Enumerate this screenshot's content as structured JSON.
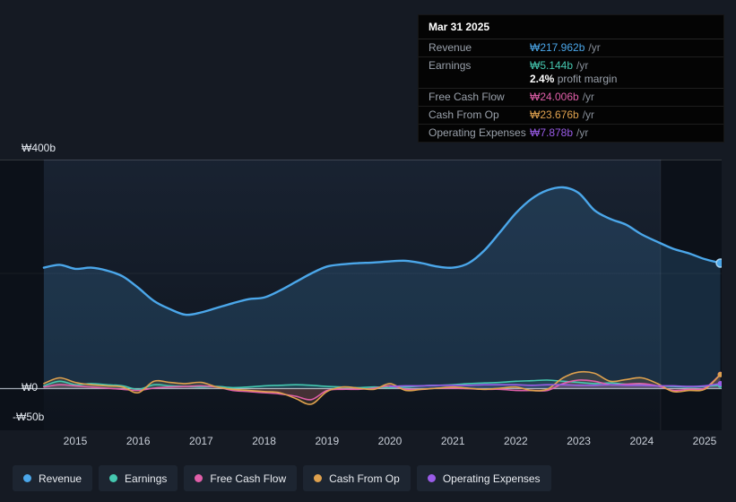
{
  "tooltip": {
    "date": "Mar 31 2025",
    "rows": [
      {
        "label": "Revenue",
        "value": "₩217.962b",
        "suffix": "/yr",
        "color": "#4ba7ea"
      },
      {
        "label": "Earnings",
        "value": "₩5.144b",
        "suffix": "/yr",
        "color": "#45c8b0",
        "sub": {
          "value": "2.4%",
          "label": "profit margin"
        }
      },
      {
        "label": "Free Cash Flow",
        "value": "₩24.006b",
        "suffix": "/yr",
        "color": "#e05fa9"
      },
      {
        "label": "Cash From Op",
        "value": "₩23.676b",
        "suffix": "/yr",
        "color": "#dfa14e"
      },
      {
        "label": "Operating Expenses",
        "value": "₩7.878b",
        "suffix": "/yr",
        "color": "#9a5ce8"
      }
    ]
  },
  "axis": {
    "y_top": "₩400b",
    "y_zero": "₩0",
    "y_neg": "-₩50b",
    "x_ticks": [
      "2015",
      "2016",
      "2017",
      "2018",
      "2019",
      "2020",
      "2021",
      "2022",
      "2023",
      "2024",
      "2025"
    ]
  },
  "legend": [
    {
      "label": "Revenue",
      "color": "#4ba7ea"
    },
    {
      "label": "Earnings",
      "color": "#45c8b0"
    },
    {
      "label": "Free Cash Flow",
      "color": "#e05fa9"
    },
    {
      "label": "Cash From Op",
      "color": "#dfa14e"
    },
    {
      "label": "Operating Expenses",
      "color": "#9a5ce8"
    }
  ],
  "chart_data": {
    "type": "line",
    "unit": "₩ billions per year",
    "x_unit": "year",
    "legend_position": "bottom",
    "ylim": [
      -75,
      400
    ],
    "y_ticks_labeled": [
      {
        "value": 400,
        "label": "₩400b"
      },
      {
        "value": 0,
        "label": "₩0"
      },
      {
        "value": -50,
        "label": "-₩50b"
      }
    ],
    "highlight_divider_x": 2024.3,
    "x": [
      2014.5,
      2014.75,
      2015,
      2015.25,
      2015.5,
      2015.75,
      2016,
      2016.25,
      2016.5,
      2016.75,
      2017,
      2017.25,
      2017.5,
      2017.75,
      2018,
      2018.25,
      2018.5,
      2018.75,
      2019,
      2019.25,
      2019.5,
      2019.75,
      2020,
      2020.25,
      2020.5,
      2020.75,
      2021,
      2021.25,
      2021.5,
      2021.75,
      2022,
      2022.25,
      2022.5,
      2022.75,
      2023,
      2023.25,
      2023.5,
      2023.75,
      2024,
      2024.25,
      2024.5,
      2024.75,
      2025,
      2025.25
    ],
    "series": [
      {
        "name": "Revenue",
        "color": "#4ba7ea",
        "fill": true,
        "values": [
          210,
          215,
          208,
          210,
          205,
          195,
          175,
          152,
          138,
          128,
          132,
          140,
          148,
          155,
          158,
          170,
          185,
          200,
          212,
          216,
          218,
          219,
          221,
          222,
          218,
          212,
          210,
          218,
          240,
          272,
          305,
          330,
          345,
          350,
          340,
          310,
          295,
          285,
          268,
          255,
          243,
          235,
          225,
          218
        ]
      },
      {
        "name": "Earnings",
        "color": "#45c8b0",
        "values": [
          4,
          12,
          6,
          8,
          6,
          4,
          -2,
          6,
          4,
          3,
          2,
          3,
          1,
          2,
          4,
          5,
          6,
          5,
          3,
          2,
          1,
          2,
          1,
          2,
          4,
          5,
          6,
          8,
          9,
          10,
          12,
          13,
          14,
          12,
          10,
          8,
          9,
          7,
          6,
          4,
          3,
          2,
          3,
          5.1
        ]
      },
      {
        "name": "Free Cash Flow",
        "color": "#e05fa9",
        "values": [
          2,
          6,
          4,
          2,
          0,
          -2,
          -4,
          0,
          2,
          3,
          4,
          2,
          -4,
          -6,
          -8,
          -10,
          -14,
          -20,
          -4,
          -2,
          -2,
          0,
          4,
          -2,
          -2,
          0,
          0,
          -1,
          -2,
          -2,
          -4,
          -4,
          -4,
          8,
          14,
          12,
          6,
          7,
          8,
          4,
          -4,
          -2,
          0,
          24
        ]
      },
      {
        "name": "Cash From Op",
        "color": "#dfa14e",
        "values": [
          8,
          18,
          10,
          6,
          4,
          2,
          -8,
          12,
          10,
          8,
          10,
          2,
          -2,
          -4,
          -6,
          -8,
          -18,
          -28,
          -6,
          2,
          0,
          -2,
          8,
          -4,
          -2,
          0,
          2,
          0,
          -2,
          0,
          2,
          -4,
          -2,
          18,
          28,
          26,
          12,
          15,
          18,
          8,
          -6,
          -4,
          -2,
          23.7
        ]
      },
      {
        "name": "Operating Expenses",
        "color": "#9a5ce8",
        "values": [
          null,
          null,
          null,
          null,
          null,
          null,
          null,
          null,
          null,
          null,
          null,
          null,
          null,
          null,
          null,
          null,
          null,
          null,
          null,
          null,
          null,
          null,
          3,
          4,
          4,
          5,
          5,
          5,
          6,
          6,
          6,
          5,
          6,
          6,
          5,
          5,
          6,
          5,
          5,
          4,
          4,
          3,
          4,
          7.9
        ]
      }
    ]
  }
}
